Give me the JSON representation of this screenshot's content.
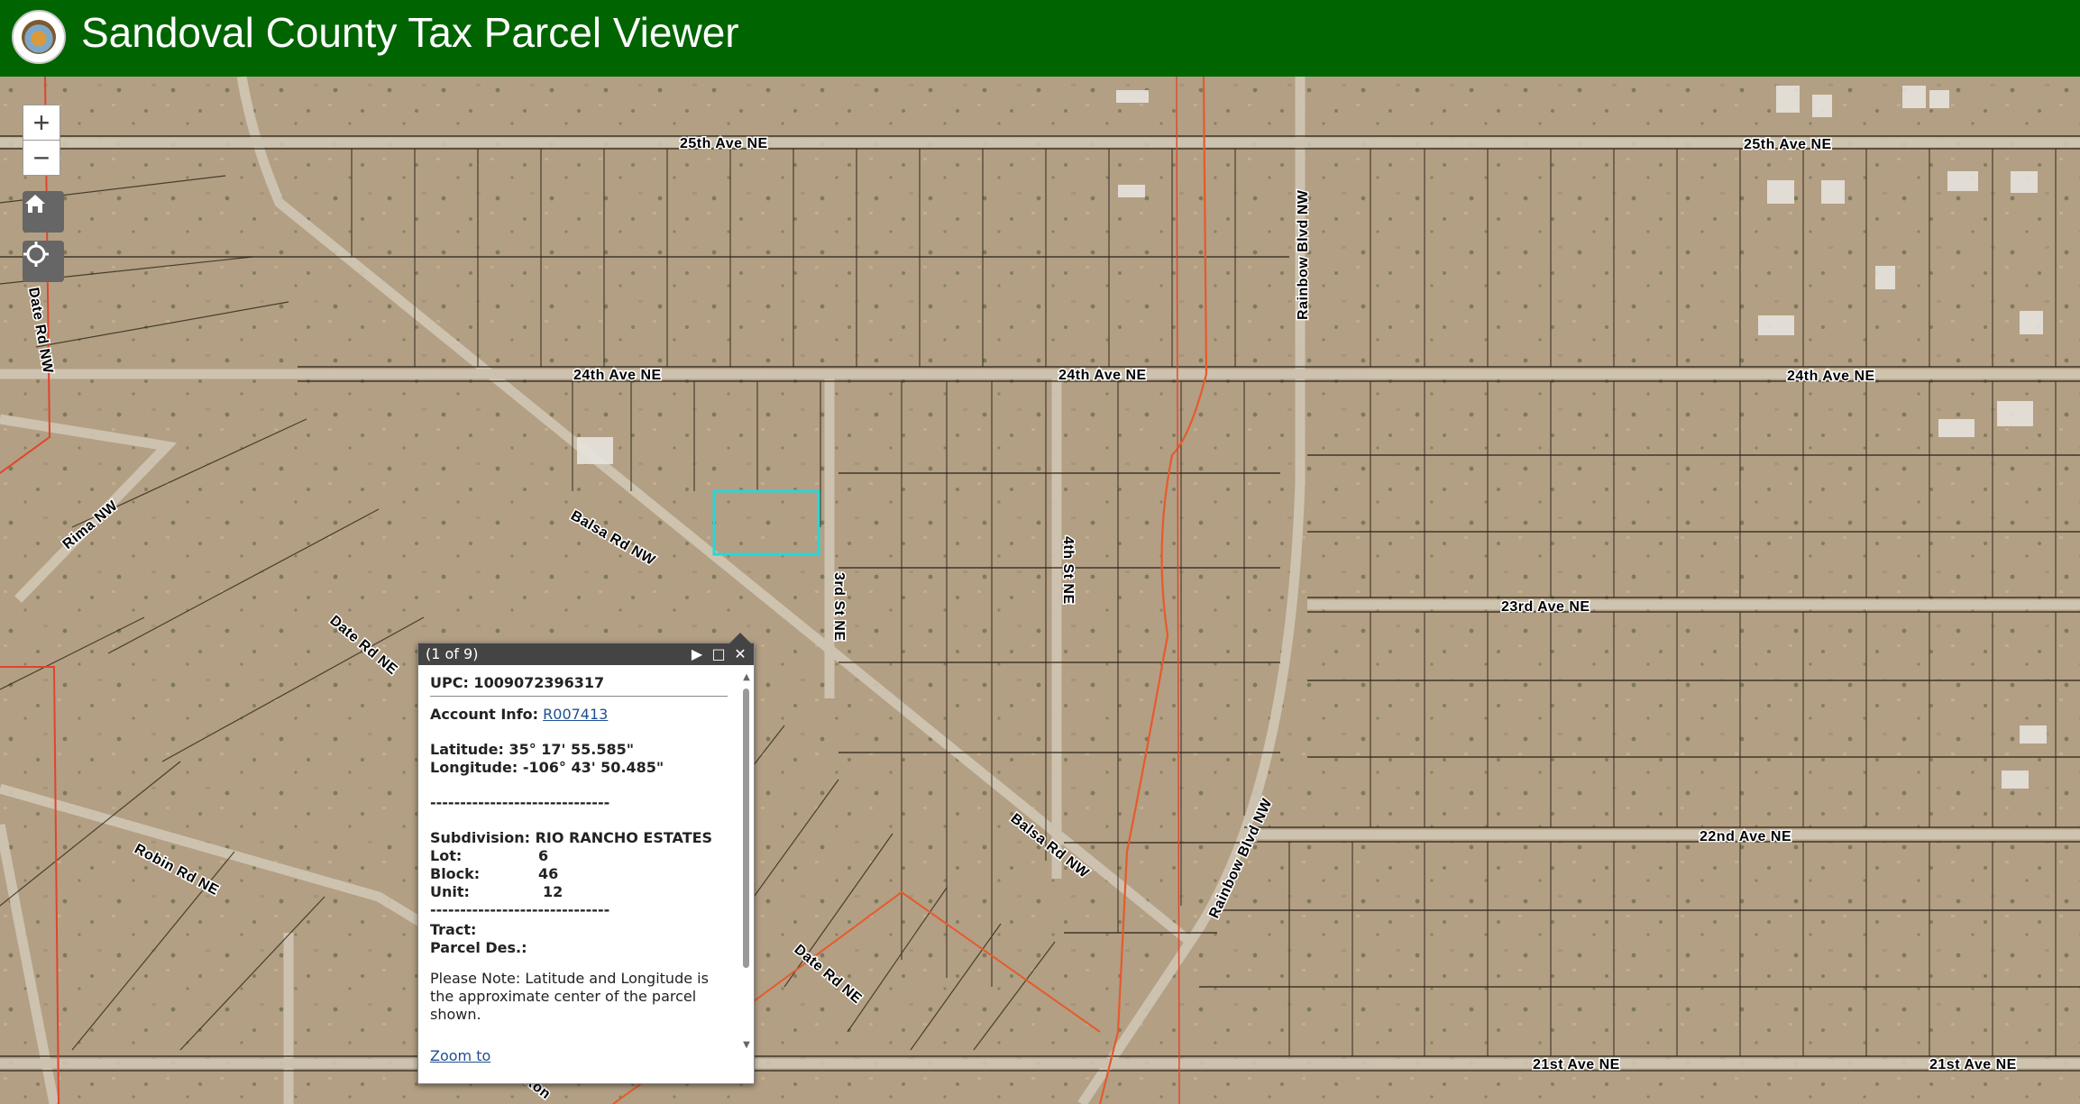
{
  "header": {
    "title": "Sandoval County Tax Parcel Viewer",
    "seal_icon": "county-seal-icon"
  },
  "controls": {
    "zoom_in": "+",
    "zoom_out": "−",
    "home_icon": "home-icon",
    "locate_icon": "locate-icon"
  },
  "road_labels": {
    "ave25_left": "25th Ave  NE",
    "ave25_right": "25th Ave NE",
    "ave24_a": "24th Ave NE",
    "ave24_b": "24th Ave NE",
    "ave24_c": "24th Ave NE",
    "ave23": "23rd Ave NE",
    "ave22": "22nd Ave NE",
    "ave21_a": "21st Ave NE",
    "ave21_b": "21st Ave NE",
    "st3": "3rd St NE",
    "st4": "4th St NE",
    "rainbow_top": "Rainbow Blvd NW",
    "rainbow_bottom": "Rainbow Blvd NW",
    "date_top": "Date Rd NW",
    "date_mid": "Date Rd NE",
    "date_low": "Date Rd NE",
    "rima": "Rima NW",
    "robin": "Robin Rd NE",
    "balsa_top": "Balsa Rd NW",
    "balsa_low": "Balsa Rd NW",
    "ron": "Ron"
  },
  "popup": {
    "counter": "(1 of 9)",
    "upc": "UPC: 1009072396317",
    "account_label": "Account Info:",
    "account_link": "R007413",
    "latitude": "Latitude: 35° 17' 55.585\"",
    "longitude": "Longitude: -106° 43' 50.485\"",
    "divider": "------------------------------",
    "subdivision": "Subdivision: RIO RANCHO ESTATES",
    "lot_label": "Lot:",
    "lot_value": "6",
    "block_label": "Block:",
    "block_value": "46",
    "unit_label": "Unit:",
    "unit_value": "12",
    "divider2": "------------------------------",
    "tract_label": "Tract:",
    "parcel_des_label": "Parcel Des.:",
    "note": "Please Note: Latitude and Longitude is the approximate center of the parcel shown.",
    "zoom_to": "Zoom to",
    "next_icon": "next-icon",
    "maximize_icon": "maximize-icon",
    "close_icon": "close-icon"
  },
  "colors": {
    "header": "#006400",
    "terrain": "#b39f84",
    "parcel_line": "#2d2618",
    "highlight": "#29d6d6",
    "boundary": "#e0452c"
  }
}
